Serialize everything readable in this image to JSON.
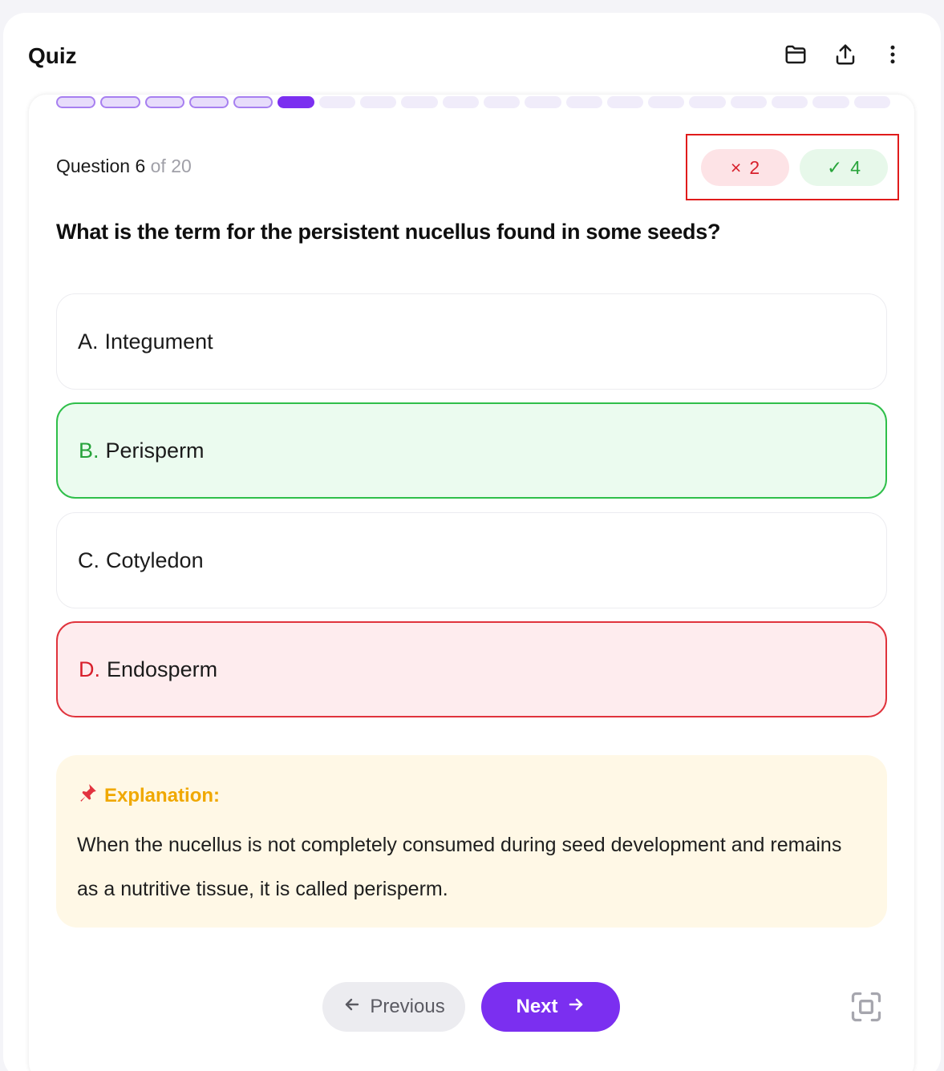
{
  "header": {
    "title": "Quiz",
    "icons": [
      "folder-icon",
      "share-upload-icon",
      "more-vertical-icon"
    ]
  },
  "progress": {
    "total": 20,
    "current": 6,
    "answered": 5
  },
  "question_counter": {
    "prefix": "Question",
    "current": "6",
    "of_text": "of 20"
  },
  "score": {
    "wrong_symbol": "×",
    "wrong_count": "2",
    "right_symbol": "✓",
    "right_count": "4"
  },
  "question": {
    "text": "What is the term for the persistent nucellus found in some seeds?"
  },
  "options": [
    {
      "letter": "A.",
      "text": "Integument",
      "state": "neutral"
    },
    {
      "letter": "B.",
      "text": "Perisperm",
      "state": "correct"
    },
    {
      "letter": "C.",
      "text": "Cotyledon",
      "state": "neutral"
    },
    {
      "letter": "D.",
      "text": "Endosperm",
      "state": "incorrect"
    }
  ],
  "explanation": {
    "icon": "pushpin-icon",
    "title": "Explanation:",
    "text": "When the nucellus is not completely consumed during seed development and remains as a nutritive tissue, it is called perisperm."
  },
  "nav": {
    "previous_label": "Previous",
    "next_label": "Next"
  },
  "colors": {
    "accent": "#7b2ff0",
    "correct": "#2fbf4a",
    "incorrect": "#e0333c",
    "highlight_box": "#e01b1b"
  }
}
